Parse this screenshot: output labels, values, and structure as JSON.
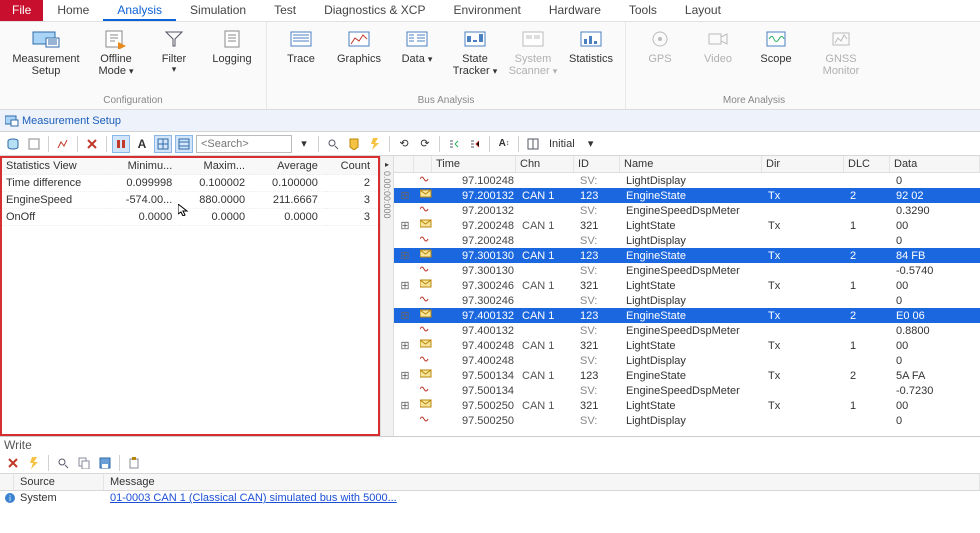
{
  "tabs": {
    "file": "File",
    "home": "Home",
    "analysis": "Analysis",
    "simulation": "Simulation",
    "test": "Test",
    "diag": "Diagnostics & XCP",
    "env": "Environment",
    "hw": "Hardware",
    "tools": "Tools",
    "layout": "Layout",
    "active": "analysis"
  },
  "ribbon": {
    "groups": {
      "configuration": {
        "label": "Configuration",
        "items": {
          "meas_setup": "Measurement Setup",
          "offline_mode": "Offline Mode ",
          "filter": "Filter",
          "logging": "Logging"
        }
      },
      "bus_analysis": {
        "label": "Bus Analysis",
        "items": {
          "trace": "Trace",
          "graphics": "Graphics",
          "data": "Data",
          "state_tracker": "State Tracker ",
          "system_scanner": "System Scanner ",
          "statistics": "Statistics"
        }
      },
      "more": {
        "label": "More Analysis",
        "items": {
          "gps": "GPS",
          "video": "Video",
          "scope": "Scope",
          "gnss": "GNSS Monitor"
        }
      }
    }
  },
  "smallbar": {
    "meas_setup": "Measurement Setup"
  },
  "toolbar2": {
    "search_placeholder": "<Search>",
    "initial_label": "Initial"
  },
  "stats": {
    "headers": {
      "view": "Statistics View",
      "min": "Minimu...",
      "max": "Maxim...",
      "avg": "Average",
      "count": "Count"
    },
    "rows": [
      {
        "label": "Time difference",
        "min": "0.099998",
        "max": "0.100002",
        "avg": "0.100000",
        "count": "2"
      },
      {
        "label": "EngineSpeed",
        "min": "-574.00...",
        "max": "880.0000",
        "avg": "211.6667",
        "count": "3"
      },
      {
        "label": "OnOff",
        "min": "0.0000",
        "max": "0.0000",
        "avg": "0.0000",
        "count": "3"
      }
    ]
  },
  "vgutter": {
    "label": "0.00:00:000"
  },
  "trace": {
    "headers": {
      "time": "Time",
      "chn": "Chn",
      "id": "ID",
      "name": "Name",
      "dir": "Dir",
      "dlc": "DLC",
      "data": "Data"
    },
    "rows": [
      {
        "tree": "",
        "time": "97.100248",
        "chn": "",
        "id": "SV:",
        "name": "LightDisplay",
        "dir": "",
        "dlc": "",
        "data": "0",
        "sv": true,
        "sel": false
      },
      {
        "tree": "+",
        "time": "97.200132",
        "chn": "CAN 1",
        "id": "123",
        "name": "EngineState",
        "dir": "Tx",
        "dlc": "2",
        "data": "92 02",
        "sv": false,
        "sel": true
      },
      {
        "tree": "",
        "time": "97.200132",
        "chn": "",
        "id": "SV:",
        "name": "EngineSpeedDspMeter",
        "dir": "",
        "dlc": "",
        "data": "0.3290",
        "sv": true,
        "sel": false
      },
      {
        "tree": "+",
        "time": "97.200248",
        "chn": "CAN 1",
        "id": "321",
        "name": "LightState",
        "dir": "Tx",
        "dlc": "1",
        "data": "00",
        "sv": false,
        "sel": false
      },
      {
        "tree": "",
        "time": "97.200248",
        "chn": "",
        "id": "SV:",
        "name": "LightDisplay",
        "dir": "",
        "dlc": "",
        "data": "0",
        "sv": true,
        "sel": false
      },
      {
        "tree": "+",
        "time": "97.300130",
        "chn": "CAN 1",
        "id": "123",
        "name": "EngineState",
        "dir": "Tx",
        "dlc": "2",
        "data": "84 FB",
        "sv": false,
        "sel": true
      },
      {
        "tree": "",
        "time": "97.300130",
        "chn": "",
        "id": "SV:",
        "name": "EngineSpeedDspMeter",
        "dir": "",
        "dlc": "",
        "data": "-0.5740",
        "sv": true,
        "sel": false
      },
      {
        "tree": "+",
        "time": "97.300246",
        "chn": "CAN 1",
        "id": "321",
        "name": "LightState",
        "dir": "Tx",
        "dlc": "1",
        "data": "00",
        "sv": false,
        "sel": false
      },
      {
        "tree": "",
        "time": "97.300246",
        "chn": "",
        "id": "SV:",
        "name": "LightDisplay",
        "dir": "",
        "dlc": "",
        "data": "0",
        "sv": true,
        "sel": false
      },
      {
        "tree": "+",
        "time": "97.400132",
        "chn": "CAN 1",
        "id": "123",
        "name": "EngineState",
        "dir": "Tx",
        "dlc": "2",
        "data": "E0 06",
        "sv": false,
        "sel": true
      },
      {
        "tree": "",
        "time": "97.400132",
        "chn": "",
        "id": "SV:",
        "name": "EngineSpeedDspMeter",
        "dir": "",
        "dlc": "",
        "data": "0.8800",
        "sv": true,
        "sel": false
      },
      {
        "tree": "+",
        "time": "97.400248",
        "chn": "CAN 1",
        "id": "321",
        "name": "LightState",
        "dir": "Tx",
        "dlc": "1",
        "data": "00",
        "sv": false,
        "sel": false
      },
      {
        "tree": "",
        "time": "97.400248",
        "chn": "",
        "id": "SV:",
        "name": "LightDisplay",
        "dir": "",
        "dlc": "",
        "data": "0",
        "sv": true,
        "sel": false
      },
      {
        "tree": "+",
        "time": "97.500134",
        "chn": "CAN 1",
        "id": "123",
        "name": "EngineState",
        "dir": "Tx",
        "dlc": "2",
        "data": "5A FA",
        "sv": false,
        "sel": false
      },
      {
        "tree": "",
        "time": "97.500134",
        "chn": "",
        "id": "SV:",
        "name": "EngineSpeedDspMeter",
        "dir": "",
        "dlc": "",
        "data": "-0.7230",
        "sv": true,
        "sel": false
      },
      {
        "tree": "+",
        "time": "97.500250",
        "chn": "CAN 1",
        "id": "321",
        "name": "LightState",
        "dir": "Tx",
        "dlc": "1",
        "data": "00",
        "sv": false,
        "sel": false
      },
      {
        "tree": "",
        "time": "97.500250",
        "chn": "",
        "id": "SV:",
        "name": "LightDisplay",
        "dir": "",
        "dlc": "",
        "data": "0",
        "sv": true,
        "sel": false
      }
    ]
  },
  "write": {
    "title": "Write",
    "headers": {
      "source": "Source",
      "message": "Message"
    },
    "rows": [
      {
        "source": "System",
        "message": "01-0003 CAN 1 (Classical CAN)  simulated bus with 5000..."
      }
    ]
  }
}
